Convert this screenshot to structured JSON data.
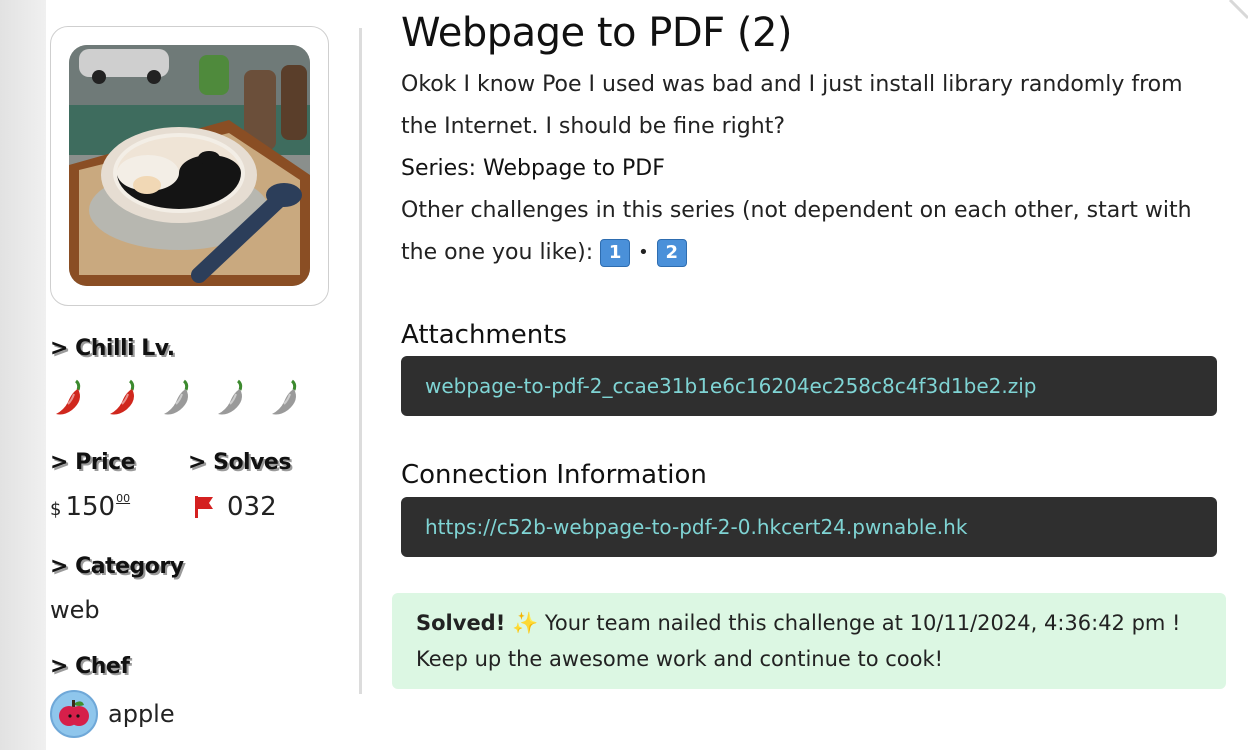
{
  "sidebar": {
    "chilli_label": "> Chilli Lv.",
    "chilli_level": 2,
    "chilli_max": 5,
    "price_label": "> Price",
    "price_currency": "$",
    "price_amount": "150",
    "price_cents": "00",
    "solves_label": "> Solves",
    "solves_value": "032",
    "category_label": "> Category",
    "category_value": "web",
    "chef_label": "> Chef",
    "chef_name": "apple"
  },
  "challenge": {
    "title": "Webpage to PDF (2)",
    "description": "Okok I know Poe I used was bad and I just install library randomly from the Internet. I should be fine right?",
    "series_line": "Series: Webpage to PDF",
    "other_line": "Other challenges in this series (not dependent on each other, start with the one you like):",
    "series_keys": [
      "1",
      "2"
    ],
    "series_separator": "•"
  },
  "attachments": {
    "heading": "Attachments",
    "file": "webpage-to-pdf-2_ccae31b1e6c16204ec258c8c4f3d1be2.zip"
  },
  "connection": {
    "heading": "Connection Information",
    "url": "https://c52b-webpage-to-pdf-2-0.hkcert24.pwnable.hk"
  },
  "solved": {
    "prefix": "Solved!",
    "sparkle": "✨",
    "message": "Your team nailed this challenge at 10/11/2024, 4:36:42 pm ! Keep up the awesome work and continue to cook!"
  },
  "colors": {
    "chilli_active": "#d0271d",
    "chilli_inactive": "#9a9a9a",
    "code_bg": "#2f2f2f",
    "code_text": "#7fd4d4",
    "solved_bg": "#dcf7e3",
    "flag": "#d42020"
  }
}
